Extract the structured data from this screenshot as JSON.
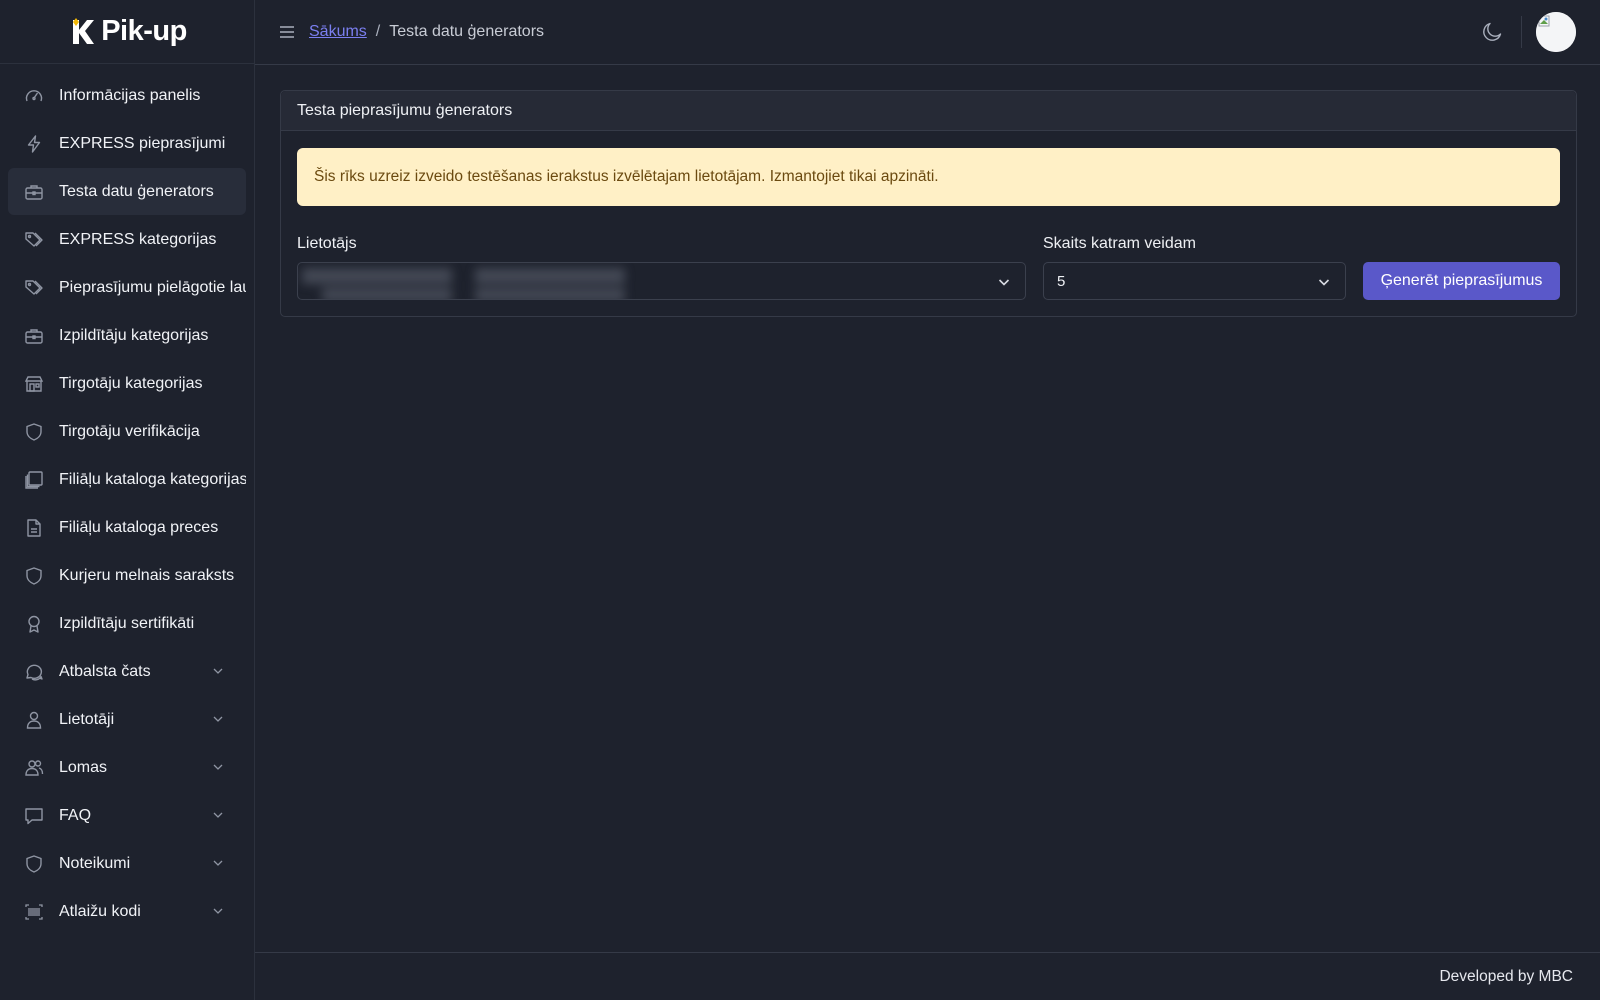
{
  "app": {
    "logo_text": "Pik-up"
  },
  "sidebar": {
    "items": [
      {
        "label": "Informācijas panelis",
        "icon": "gauge-icon"
      },
      {
        "label": "EXPRESS pieprasījumi",
        "icon": "lightning-icon"
      },
      {
        "label": "Testa datu ģenerators",
        "icon": "briefcase-icon",
        "active": true
      },
      {
        "label": "EXPRESS kategorijas",
        "icon": "tags-icon"
      },
      {
        "label": "Pieprasījumu pielāgotie lauki",
        "icon": "tags-icon"
      },
      {
        "label": "Izpildītāju kategorijas",
        "icon": "briefcase-icon"
      },
      {
        "label": "Tirgotāju kategorijas",
        "icon": "shop-icon"
      },
      {
        "label": "Tirgotāju verifikācija",
        "icon": "shield-icon"
      },
      {
        "label": "Filiāļu kataloga kategorijas",
        "icon": "collection-icon"
      },
      {
        "label": "Filiāļu kataloga preces",
        "icon": "file-text-icon"
      },
      {
        "label": "Kurjeru melnais saraksts",
        "icon": "shield-icon"
      },
      {
        "label": "Izpildītāju sertifikāti",
        "icon": "award-icon"
      },
      {
        "label": "Atbalsta čats",
        "icon": "chat-icon",
        "expandable": true
      },
      {
        "label": "Lietotāji",
        "icon": "person-icon",
        "expandable": true
      },
      {
        "label": "Lomas",
        "icon": "people-icon",
        "expandable": true
      },
      {
        "label": "FAQ",
        "icon": "chat-square-icon",
        "expandable": true
      },
      {
        "label": "Noteikumi",
        "icon": "shield-icon",
        "expandable": true
      },
      {
        "label": "Atlaižu kodi",
        "icon": "barcode-icon",
        "expandable": true
      }
    ]
  },
  "header": {
    "breadcrumb_home": "Sākums",
    "breadcrumb_sep": "/",
    "breadcrumb_current": "Testa datu ģenerators"
  },
  "card": {
    "title": "Testa pieprasījumu ģenerators",
    "alert": "Šis rīks uzreiz izveido testēšanas ierakstus izvēlētajam lietotājam. Izmantojiet tikai apzināti.",
    "user_label": "Lietotājs",
    "count_label": "Skaits katram veidam",
    "count_value": "5",
    "generate_button": "Ģenerēt pieprasījumus"
  },
  "footer": {
    "text": "Developed by MBC"
  },
  "colors": {
    "background": "#1e222d",
    "accent": "#5a58c9",
    "link": "#7b7ff0",
    "alert_bg": "#fff0c6",
    "alert_text": "#6b4a10",
    "logo_accent": "#f2b705"
  }
}
